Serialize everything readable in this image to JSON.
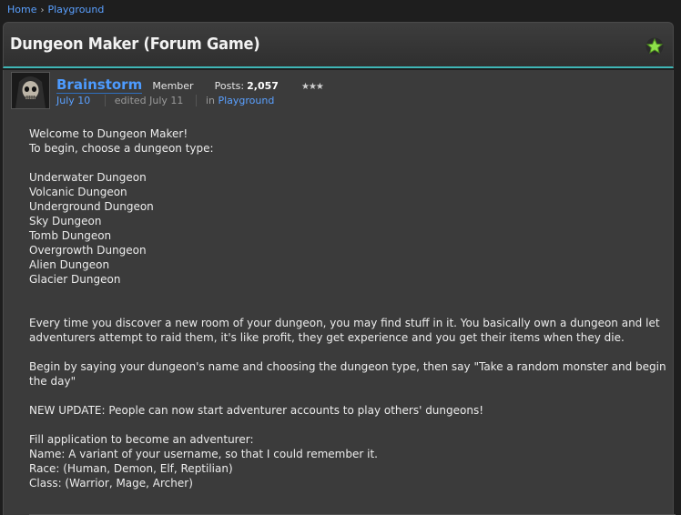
{
  "breadcrumb": {
    "home": "Home",
    "separator": "›",
    "current": "Playground"
  },
  "discussion": {
    "title": "Dungeon Maker (Forum Game)",
    "bookmark_icon": "star-icon",
    "accent": "#3fb6b6"
  },
  "post": {
    "author": "Brainstorm",
    "role": "Member",
    "posts_label": "Posts:",
    "posts_count": "2,057",
    "rank": "★★★",
    "date": "July 10",
    "edited": "edited July 11",
    "in_label": "in",
    "category": "Playground",
    "body": {
      "intro": [
        "Welcome to Dungeon Maker!",
        "To begin, choose a dungeon type:"
      ],
      "dungeons": [
        "Underwater Dungeon",
        "Volcanic Dungeon",
        "Underground Dungeon",
        "Sky Dungeon",
        "Tomb Dungeon",
        "Overgrowth Dungeon",
        "Alien Dungeon",
        "Glacier Dungeon"
      ],
      "explain": "Every time you discover a new room of your dungeon, you may find stuff in it. You basically own a dungeon and let adventurers attempt to raid them, it's like profit, they get experience and you get their items when they die.",
      "begin": "Begin by saying your dungeon's name and choosing the dungeon type, then say \"Take a random monster and begin the day\"",
      "update": "NEW UPDATE: People can now start adventurer accounts to play others' dungeons!",
      "application": [
        "Fill application to become an adventurer:",
        "Name: A variant of your username, so that I could remember it.",
        "Race: (Human, Demon, Elf, Reptilian)",
        "Class: (Warrior, Mage, Archer)"
      ]
    }
  }
}
